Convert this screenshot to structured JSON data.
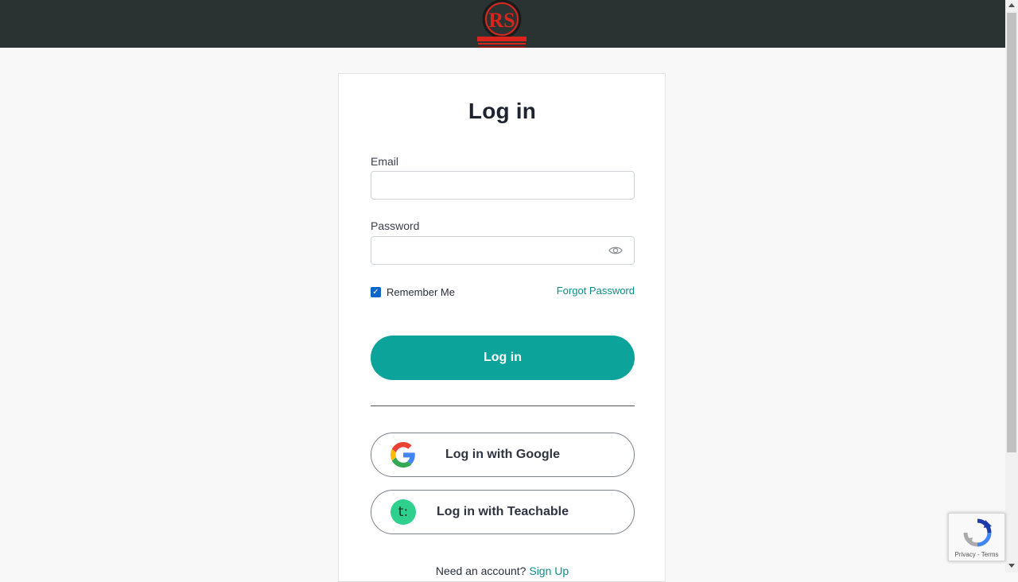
{
  "header": {
    "logo_name": "rs-logo",
    "brand_color": "#d9251c",
    "background": "#2b3332"
  },
  "login_form": {
    "title": "Log in",
    "email_label": "Email",
    "email_value": "",
    "password_label": "Password",
    "password_value": "",
    "remember_me_label": "Remember Me",
    "remember_me_checked": true,
    "forgot_password_label": "Forgot Password",
    "submit_label": "Log in",
    "google_label": "Log in with Google",
    "teachable_label": "Log in with Teachable",
    "teachable_icon_glyph": "t:",
    "signup_prompt": "Need an account?",
    "signup_link_label": "Sign Up"
  },
  "recaptcha": {
    "privacy_label": "Privacy",
    "separator": "-",
    "terms_label": "Terms"
  },
  "colors": {
    "accent": "#0ca39a",
    "link": "#0b8f89",
    "checkbox": "#0b65c8",
    "teachable_green": "#2fcf8e"
  },
  "icons": {
    "password_toggle": "eye-icon",
    "google": "google-g-icon",
    "teachable": "teachable-icon",
    "recaptcha": "recaptcha-icon"
  }
}
